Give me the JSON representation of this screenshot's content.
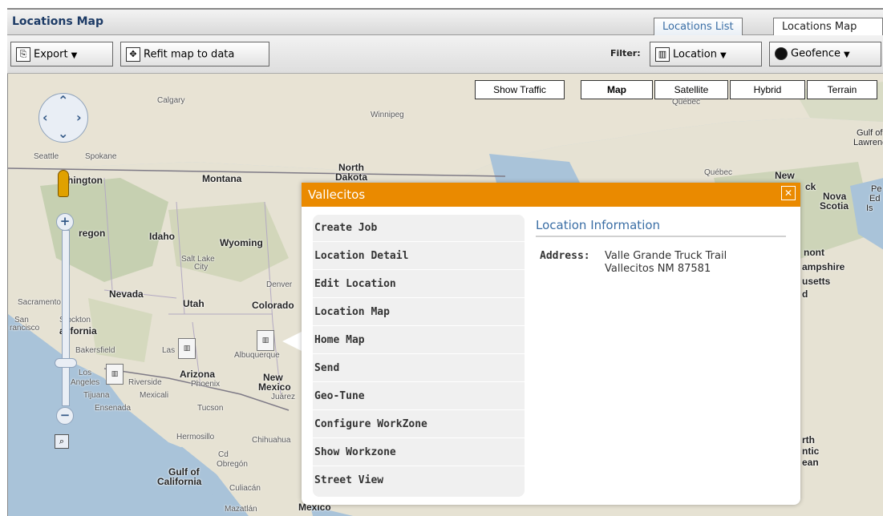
{
  "window": {
    "title": "Locations Map"
  },
  "tabs": [
    {
      "label": "Locations List",
      "active": true
    },
    {
      "label": "Locations Map",
      "active": false
    }
  ],
  "toolbar": {
    "export_label": "Export",
    "refit_label": "Refit map to data",
    "filter_label": "Filter:",
    "location_filter_label": "Location",
    "geofence_filter_label": "Geofence"
  },
  "map_types": {
    "traffic": "Show Traffic",
    "map": "Map",
    "satellite": "Satellite",
    "hybrid": "Hybrid",
    "terrain": "Terrain",
    "active": "Map"
  },
  "map_labels": {
    "calgary": "Calgary",
    "winnipeg": "Winnipeg",
    "quebec": "Québec",
    "gulf_st": "Gulf of S",
    "lawrence": "Lawrenc",
    "seattle": "Seattle",
    "spokane": "Spokane",
    "washington": "hington",
    "montana": "Montana",
    "north_dakota_1": "North",
    "north_dakota_2": "Dakota",
    "quebec2": "Québec",
    "new": "New",
    "ck": "ck",
    "nova_1": "Nova",
    "nova_2": "Scotia",
    "pe": "Pe",
    "ed": "Ed",
    "is": "Is",
    "oregon": "regon",
    "idaho": "Idaho",
    "wyoming": "Wyoming",
    "salt_lake": "Salt Lake",
    "city": "City",
    "vermont": "nont",
    "hampshire": "ampshire",
    "usetts": "usetts",
    "d": "d",
    "nevada": "Nevada",
    "utah": "Utah",
    "denver": "Denver",
    "colorado": "Colorado",
    "sacramento": "Sacramento",
    "san": "San",
    "francisco": "rancisco",
    "stockton": "Stockton",
    "california": "alifornia",
    "bakersfield": "Bakersfield",
    "las": "Las",
    "albuquerque": "Albuquerque",
    "los": "Los",
    "angeles": "Angeles",
    "riverside": "Riverside",
    "arizona": "Arizona",
    "phoenix": "Phoenix",
    "new_mexico_1": "New",
    "new_mexico_2": "Mexico",
    "tijuana": "Tijuana",
    "mexicali": "Mexicali",
    "juarez": "Juárez",
    "ensenada": "Ensenada",
    "tucson": "Tucson",
    "hermosillo": "Hermosillo",
    "chihuahua": "Chihuahua",
    "cd": "Cd",
    "obregon": "Obregón",
    "gulf_ca_1": "Gulf of",
    "gulf_ca_2": "California",
    "culiacan": "Culiacán",
    "mazatlan": "Mazatlán",
    "mexico": "México",
    "rth": "rth",
    "ntic": "ntic",
    "ean": "ean"
  },
  "popup": {
    "title": "Vallecitos",
    "close_glyph": "✕",
    "actions": [
      "Create Job",
      "Location Detail",
      "Edit Location",
      "Location Map",
      "Home Map",
      "Send",
      "Geo-Tune",
      "Configure WorkZone",
      "Show Workzone",
      "Street View"
    ],
    "info_title": "Location Information",
    "address_label": "Address:",
    "address_line1": "Valle Grande Truck Trail",
    "address_line2": "Vallecitos NM 87581"
  },
  "icons": {
    "export": "export-icon",
    "refit": "refit-map-icon",
    "location_filter": "location-filter-icon",
    "geofence_filter": "geofence-icon",
    "marker": "location-marker-icon"
  },
  "colors": {
    "popup_header": "#ea8a00",
    "info_title": "#3a6ea5",
    "active_tab_text": "#3a6ea5"
  }
}
